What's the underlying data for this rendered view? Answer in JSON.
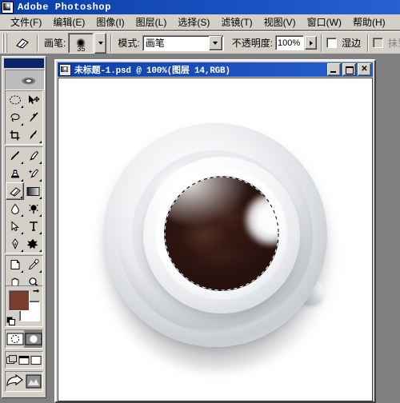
{
  "app": {
    "title": "Adobe Photoshop",
    "icon": "photoshop-app-icon"
  },
  "menubar": {
    "items": [
      {
        "label": "文件(F)",
        "name": "menu-file"
      },
      {
        "label": "编辑(E)",
        "name": "menu-edit"
      },
      {
        "label": "图像(I)",
        "name": "menu-image"
      },
      {
        "label": "图层(L)",
        "name": "menu-layer"
      },
      {
        "label": "选择(S)",
        "name": "menu-select"
      },
      {
        "label": "滤镜(T)",
        "name": "menu-filter"
      },
      {
        "label": "视图(V)",
        "name": "menu-view"
      },
      {
        "label": "窗口(W)",
        "name": "menu-window"
      },
      {
        "label": "帮助(H)",
        "name": "menu-help"
      }
    ]
  },
  "options_bar": {
    "active_tool_icon": "eraser-icon",
    "brush_label": "画笔:",
    "brush_size": "35",
    "mode_label": "模式:",
    "mode_value": "画笔",
    "opacity_label": "不透明度:",
    "opacity_value": "100%",
    "wet_edges_label": "湿边",
    "wet_edges_checked": false,
    "erase_to_history_label": "抹到历",
    "erase_to_history_enabled": false
  },
  "toolbox": {
    "tools": [
      [
        {
          "name": "marquee-elliptical-tool",
          "icon": "ellipse-dashed-icon",
          "selected": false,
          "has_flyout": true
        },
        {
          "name": "move-tool",
          "icon": "move-arrow-icon",
          "selected": false,
          "has_flyout": false
        }
      ],
      [
        {
          "name": "lasso-tool",
          "icon": "lasso-icon",
          "selected": false,
          "has_flyout": true
        },
        {
          "name": "magic-wand-tool",
          "icon": "magic-wand-icon",
          "selected": false,
          "has_flyout": false
        }
      ],
      [
        {
          "name": "crop-tool",
          "icon": "crop-icon",
          "selected": false,
          "has_flyout": false
        },
        {
          "name": "slice-tool",
          "icon": "slice-knife-icon",
          "selected": false,
          "has_flyout": true
        }
      ],
      [
        {
          "name": "healing-brush-tool",
          "icon": "healing-brush-icon",
          "selected": false,
          "has_flyout": true
        },
        {
          "name": "paintbrush-tool",
          "icon": "paintbrush-icon",
          "selected": false,
          "has_flyout": true
        }
      ],
      [
        {
          "name": "clone-stamp-tool",
          "icon": "clone-stamp-icon",
          "selected": false,
          "has_flyout": true
        },
        {
          "name": "history-brush-tool",
          "icon": "history-brush-icon",
          "selected": false,
          "has_flyout": true
        }
      ],
      [
        {
          "name": "eraser-tool",
          "icon": "eraser-icon",
          "selected": true,
          "has_flyout": true
        },
        {
          "name": "gradient-tool",
          "icon": "gradient-icon",
          "selected": false,
          "has_flyout": true
        }
      ],
      [
        {
          "name": "blur-tool",
          "icon": "waterdrop-icon",
          "selected": false,
          "has_flyout": true
        },
        {
          "name": "dodge-tool",
          "icon": "dodge-burn-icon",
          "selected": false,
          "has_flyout": true
        }
      ],
      [
        {
          "name": "path-selection-tool",
          "icon": "path-arrow-icon",
          "selected": false,
          "has_flyout": true
        },
        {
          "name": "type-tool",
          "icon": "type-T-icon",
          "selected": false,
          "has_flyout": true
        }
      ],
      [
        {
          "name": "pen-tool",
          "icon": "pen-nib-icon",
          "selected": false,
          "has_flyout": true
        },
        {
          "name": "shape-tool",
          "icon": "custom-shape-star-icon",
          "selected": false,
          "has_flyout": true
        }
      ],
      [
        {
          "name": "notes-tool",
          "icon": "note-page-icon",
          "selected": false,
          "has_flyout": true
        },
        {
          "name": "eyedropper-tool",
          "icon": "eyedropper-icon",
          "selected": false,
          "has_flyout": true
        }
      ],
      [
        {
          "name": "hand-tool",
          "icon": "hand-icon",
          "selected": false,
          "has_flyout": false
        },
        {
          "name": "zoom-tool",
          "icon": "magnifier-icon",
          "selected": false,
          "has_flyout": false
        }
      ]
    ],
    "colors": {
      "foreground": "#7a3d2e",
      "background": "#ffffff",
      "swap_icon": "swap-colors-icon",
      "default_icon": "default-colors-icon"
    },
    "mode_buttons": [
      {
        "name": "standard-mask-mode-button",
        "icon": "standard-mode-icon",
        "active": false
      },
      {
        "name": "quick-mask-mode-button",
        "icon": "quick-mask-icon",
        "active": true
      }
    ],
    "screen_buttons": [
      {
        "name": "standard-screen-mode-button",
        "icon": "standard-screen-icon"
      },
      {
        "name": "full-screen-menubar-mode-button",
        "icon": "fullscreen-menu-icon"
      },
      {
        "name": "full-screen-mode-button",
        "icon": "fullscreen-icon"
      }
    ],
    "jump_buttons": [
      {
        "name": "jump-to-imageready-button",
        "icon": "jump-arrow-icon"
      },
      {
        "name": "imageready-preview-button",
        "icon": "imageready-icon"
      }
    ],
    "banner_icon": "eye-banner-image"
  },
  "document": {
    "title": "未标题-1.psd @ 100%(图层 14,RGB)",
    "icon": "psd-document-icon",
    "window_buttons": [
      {
        "name": "minimize-button",
        "glyph": "_"
      },
      {
        "name": "maximize-button",
        "glyph": "□"
      },
      {
        "name": "close-button",
        "glyph": "✕"
      }
    ],
    "zoom": "100%",
    "layer": "图层 14",
    "color_mode": "RGB",
    "artwork": {
      "subject": "coffee-cup-top-view",
      "coffee_color": "#2b1512",
      "cup_color": "#f2f3f5",
      "saucer_color": "#e3e5e9",
      "selection": "elliptical-marching-ants-around-coffee"
    }
  }
}
